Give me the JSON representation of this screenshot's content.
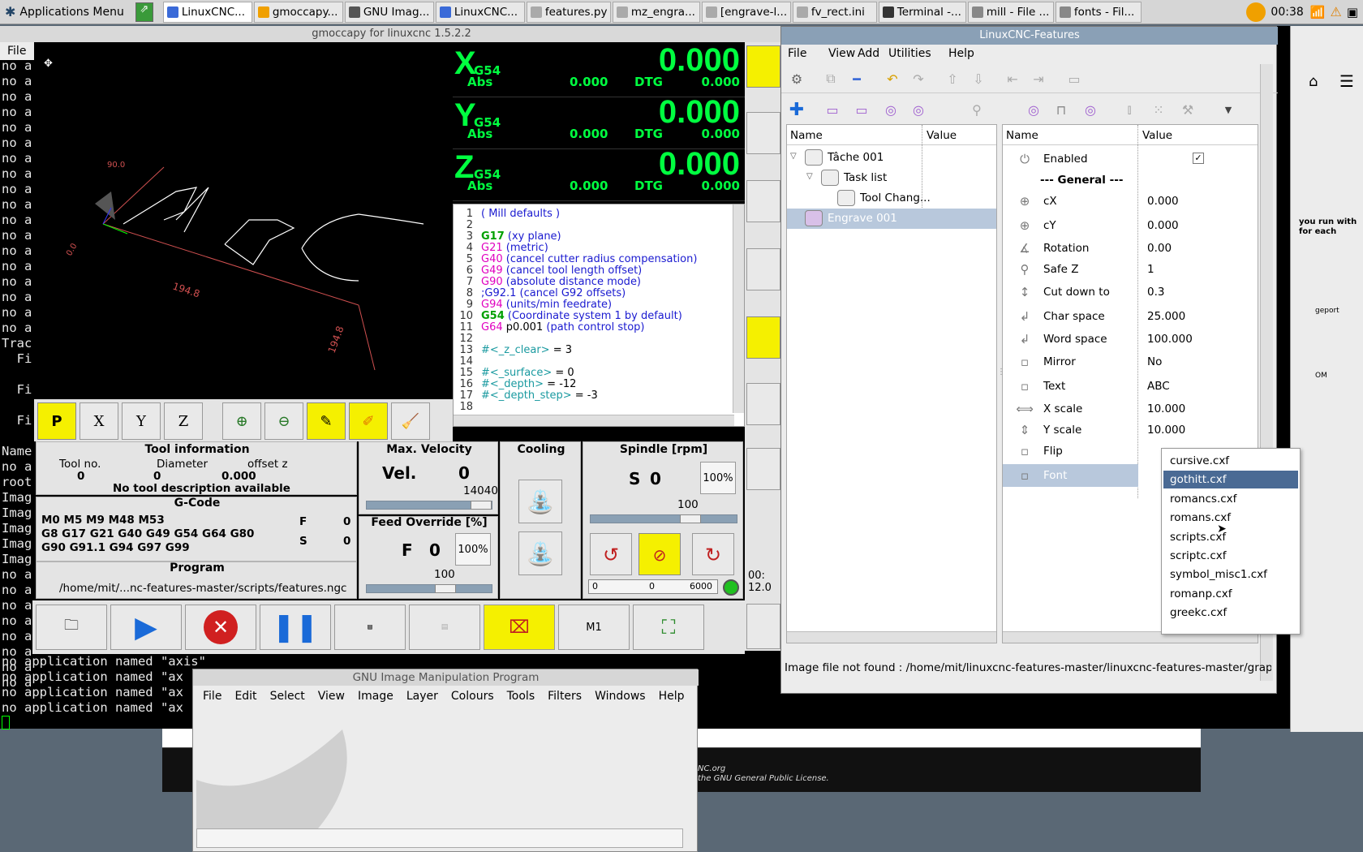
{
  "taskbar": {
    "apps_menu": "Applications Menu",
    "tasks": [
      "LinuxCNC...",
      "gmoccapy...",
      "GNU Imag...",
      "LinuxCNC...",
      "features.py",
      "mz_engra...",
      "[engrave-l...",
      "fv_rect.ini",
      "Terminal -...",
      "mill - File ...",
      "fonts - Fil..."
    ],
    "clock": "00:38"
  },
  "terminal": {
    "lines": [
      "no a",
      "no a",
      "no a",
      "no a",
      "no a",
      "no a",
      "no a",
      "no a",
      "no a",
      "no a",
      "no a",
      "no a",
      "no a",
      "no a",
      "no a",
      "no a",
      "no a",
      "no a",
      "Trac",
      "  Fi",
      "",
      "  Fi",
      "",
      "  Fi",
      "",
      "Name",
      "no a",
      "root",
      "Imag",
      "Imag",
      "Imag",
      "Imag",
      "Imag",
      "no a",
      "no a",
      "no a",
      "no a",
      "no a",
      "no a",
      "no a",
      "no a"
    ],
    "bottom_lines": [
      "no application named \"axis\"",
      "no application named \"ax",
      "no application named \"ax",
      "no application named \"ax"
    ]
  },
  "gmoccapy": {
    "title": "gmoccapy for linuxcnc  1.5.2.2",
    "menu_file": "File",
    "preview_dims": [
      "194.8",
      "194.8",
      "90.0",
      "0.0"
    ],
    "dro": [
      {
        "axis": "X",
        "sys": "G54",
        "value": "0.000",
        "abs_label": "Abs",
        "abs": "0.000",
        "dtg_label": "DTG",
        "dtg": "0.000"
      },
      {
        "axis": "Y",
        "sys": "G54",
        "value": "0.000",
        "abs_label": "Abs",
        "abs": "0.000",
        "dtg_label": "DTG",
        "dtg": "0.000"
      },
      {
        "axis": "Z",
        "sys": "G54",
        "value": "0.000",
        "abs_label": "Abs",
        "abs": "0.000",
        "dtg_label": "DTG",
        "dtg": "0.000"
      }
    ],
    "gcode_lines": [
      {
        "n": "1",
        "parts": [
          [
            "c-b",
            "( Mill defaults )"
          ]
        ]
      },
      {
        "n": "2",
        "parts": []
      },
      {
        "n": "3",
        "parts": [
          [
            "c-g",
            "G17"
          ],
          [
            "c-b",
            " (xy plane)"
          ]
        ]
      },
      {
        "n": "4",
        "parts": [
          [
            "c-m",
            "G21"
          ],
          [
            "c-b",
            " (metric)"
          ]
        ]
      },
      {
        "n": "5",
        "parts": [
          [
            "c-m",
            "G40"
          ],
          [
            "c-b",
            " (cancel cutter radius compensation)"
          ]
        ]
      },
      {
        "n": "6",
        "parts": [
          [
            "c-m",
            "G49"
          ],
          [
            "c-b",
            " (cancel tool length offset)"
          ]
        ]
      },
      {
        "n": "7",
        "parts": [
          [
            "c-m",
            "G90"
          ],
          [
            "c-b",
            " (absolute distance mode)"
          ]
        ]
      },
      {
        "n": "8",
        "parts": [
          [
            "c-b",
            ";G92.1 (cancel G92 offsets)"
          ]
        ]
      },
      {
        "n": "9",
        "parts": [
          [
            "c-m",
            "G94"
          ],
          [
            "c-b",
            " (units/min feedrate)"
          ]
        ]
      },
      {
        "n": "10",
        "parts": [
          [
            "c-g",
            "G54"
          ],
          [
            "c-b",
            " (Coordinate system 1 by default)"
          ]
        ]
      },
      {
        "n": "11",
        "parts": [
          [
            "c-m",
            "G64"
          ],
          [
            "c-k",
            " p0.001"
          ],
          [
            "c-b",
            " (path control stop)"
          ]
        ]
      },
      {
        "n": "12",
        "parts": []
      },
      {
        "n": "13",
        "parts": [
          [
            "c-t",
            "#<_z_clear>"
          ],
          [
            "c-k",
            " = 3"
          ]
        ]
      },
      {
        "n": "14",
        "parts": []
      },
      {
        "n": "15",
        "parts": [
          [
            "c-t",
            "#<_surface>"
          ],
          [
            "c-k",
            " = 0"
          ]
        ]
      },
      {
        "n": "16",
        "parts": [
          [
            "c-t",
            "#<_depth>"
          ],
          [
            "c-k",
            " = -12"
          ]
        ]
      },
      {
        "n": "17",
        "parts": [
          [
            "c-t",
            "#<_depth_step>"
          ],
          [
            "c-k",
            " = -3"
          ]
        ]
      },
      {
        "n": "18",
        "parts": []
      }
    ],
    "tool_info": {
      "title": "Tool information",
      "tool_no_label": "Tool no.",
      "tool_no": "0",
      "diameter_label": "Diameter",
      "diameter": "0",
      "offset_label": "offset z",
      "offset": "0.000",
      "desc": "No tool description available"
    },
    "gcode_panel": {
      "title": "G-Code",
      "line1": "M0 M5 M9 M48 M53",
      "line2": "G8 G17 G21 G40 G49 G54 G64 G80",
      "line3": " G90 G91.1 G94 G97 G99",
      "f_label": "F",
      "f": "0",
      "s_label": "S",
      "s": "0"
    },
    "program": {
      "title": "Program",
      "path": "/home/mit/...nc-features-master/scripts/features.ngc"
    },
    "velocity": {
      "title": "Max. Velocity",
      "label": "Vel.",
      "value": "0",
      "max": "14040"
    },
    "feed": {
      "title": "Feed Override [%]",
      "label": "F",
      "value": "0",
      "pct": "100%",
      "scale": "100"
    },
    "cooling": {
      "title": "Cooling"
    },
    "spindle": {
      "title": "Spindle [rpm]",
      "label": "S",
      "value": "0",
      "pct": "100%",
      "scale": "100",
      "bar_min": "0",
      "bar_val": "0",
      "bar_max": "6000"
    },
    "bottom": {
      "m1": "M1"
    },
    "clip": {
      "a": "00:",
      "b": "12.0"
    }
  },
  "features": {
    "title": "LinuxCNC-Features",
    "menu": [
      "File",
      "View",
      "Add",
      "Utilities",
      "Help"
    ],
    "left_headers": [
      "Name",
      "Value"
    ],
    "tree": [
      {
        "name": "Tâche 001",
        "level": 0
      },
      {
        "name": "Task list",
        "level": 1
      },
      {
        "name": "Tool Chang...",
        "level": 2
      },
      {
        "name": "Engrave 001",
        "level": 0,
        "selected": true
      }
    ],
    "right_headers": [
      "Name",
      "Value"
    ],
    "props": [
      {
        "name": "Enabled",
        "value": "✓",
        "icon": "power-icon"
      },
      {
        "name": "--- General ---",
        "value": "",
        "icon": ""
      },
      {
        "name": "cX",
        "value": "0.000",
        "icon": "crosshair-icon"
      },
      {
        "name": "cY",
        "value": "0.000",
        "icon": "crosshair-icon"
      },
      {
        "name": "Rotation",
        "value": "0.00",
        "icon": "angle-icon"
      },
      {
        "name": "Safe Z",
        "value": "1",
        "icon": "safe-z-icon"
      },
      {
        "name": "Cut down to",
        "value": "0.3",
        "icon": "cut-down-icon"
      },
      {
        "name": "Char space",
        "value": "25.000",
        "icon": "char-space-icon"
      },
      {
        "name": "Word space",
        "value": "100.000",
        "icon": "word-space-icon"
      },
      {
        "name": "Mirror",
        "value": "No",
        "icon": "mirror-icon"
      },
      {
        "name": "Text",
        "value": "ABC",
        "icon": "text-icon"
      },
      {
        "name": "X scale",
        "value": "10.000",
        "icon": "x-scale-icon"
      },
      {
        "name": "Y scale",
        "value": "10.000",
        "icon": "y-scale-icon"
      },
      {
        "name": "Flip",
        "value": "",
        "icon": "flip-icon"
      },
      {
        "name": "Font",
        "value": "",
        "icon": "font-icon"
      }
    ],
    "font_options": [
      "cursive.cxf",
      "gothitt.cxf",
      "romancs.cxf",
      "romans.cxf",
      "scripts.cxf",
      "scriptc.cxf",
      "symbol_misc1.cxf",
      "romanp.cxf",
      "greekc.cxf"
    ],
    "selected_font": "gothitt.cxf",
    "status": "Image file not found : /home/mit/linuxcnc-features-master/linuxcnc-features-master/graphi..."
  },
  "gimp": {
    "title": "GNU Image Manipulation Program",
    "menu": [
      "File",
      "Edit",
      "Select",
      "View",
      "Image",
      "Layer",
      "Colours",
      "Tools",
      "Filters",
      "Windows",
      "Help"
    ]
  },
  "background": {
    "line1": "NC.org",
    "line2": "the GNU General Public License."
  },
  "browser": {
    "text1": "you run with",
    "text2": "for each",
    "text3": "geport",
    "text4": "OM"
  }
}
